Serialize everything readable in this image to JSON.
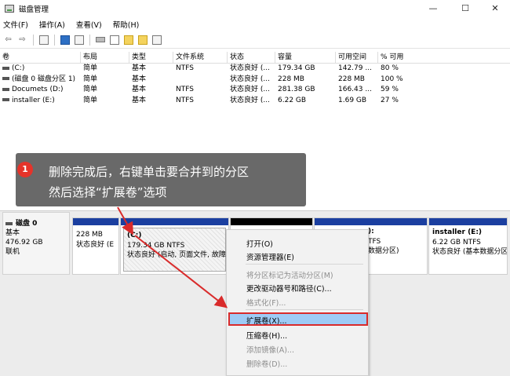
{
  "window": {
    "title": "磁盘管理",
    "minimize": "—",
    "maximize": "☐",
    "close": "✕"
  },
  "menu": [
    "文件(F)",
    "操作(A)",
    "查看(V)",
    "帮助(H)"
  ],
  "toolbar": {
    "back": "⇦",
    "forward": "⇨"
  },
  "table": {
    "headers": [
      "卷",
      "布局",
      "类型",
      "文件系统",
      "状态",
      "容量",
      "可用空间",
      "% 可用"
    ],
    "rows": [
      [
        "(C:)",
        "简单",
        "基本",
        "NTFS",
        "状态良好 (...",
        "179.34 GB",
        "142.79 ...",
        "80 %"
      ],
      [
        "(磁盘 0 磁盘分区 1)",
        "简单",
        "基本",
        "",
        "状态良好 (...",
        "228 MB",
        "228 MB",
        "100 %"
      ],
      [
        "Documets (D:)",
        "简单",
        "基本",
        "NTFS",
        "状态良好 (...",
        "281.38 GB",
        "166.43 ...",
        "59 %"
      ],
      [
        "installer (E:)",
        "简单",
        "基本",
        "NTFS",
        "状态良好 (...",
        "6.22 GB",
        "1.69 GB",
        "27 %"
      ]
    ]
  },
  "overlay": {
    "badge": "1",
    "line1": "删除完成后，右键单击要合并到的分区",
    "line2": "然后选择“扩展卷”选项"
  },
  "disk": {
    "name": "磁盘 0",
    "type": "基本",
    "size": "476.92 GB",
    "status": "联机"
  },
  "partitions": {
    "p1": {
      "size": "228 MB",
      "status": "状态良好 (E"
    },
    "p2": {
      "name": "(C:)",
      "size": "179.34 GB NTFS",
      "status": "状态良好 (启动, 页面文件, 故障"
    },
    "p3": {
      "name_tail": "):",
      "fs_tail": "TFS",
      "status_tail": "数据分区)"
    },
    "p4": {
      "name": "installer  (E:)",
      "size": "6.22 GB NTFS",
      "status": "状态良好 (基本数据分区"
    }
  },
  "context_menu": {
    "open": "打开(O)",
    "explorer": "资源管理器(E)",
    "mark_active": "将分区标记为活动分区(M)",
    "change_letter": "更改驱动器号和路径(C)...",
    "format": "格式化(F)...",
    "extend": "扩展卷(X)...",
    "shrink": "压缩卷(H)...",
    "add_mirror": "添加镜像(A)...",
    "delete": "删除卷(D)..."
  },
  "colors": {
    "partition_bar": "#1b3fa0",
    "highlight": "#9ecbf5",
    "annotation": "#d92b2b",
    "badge": "#e5332a"
  }
}
